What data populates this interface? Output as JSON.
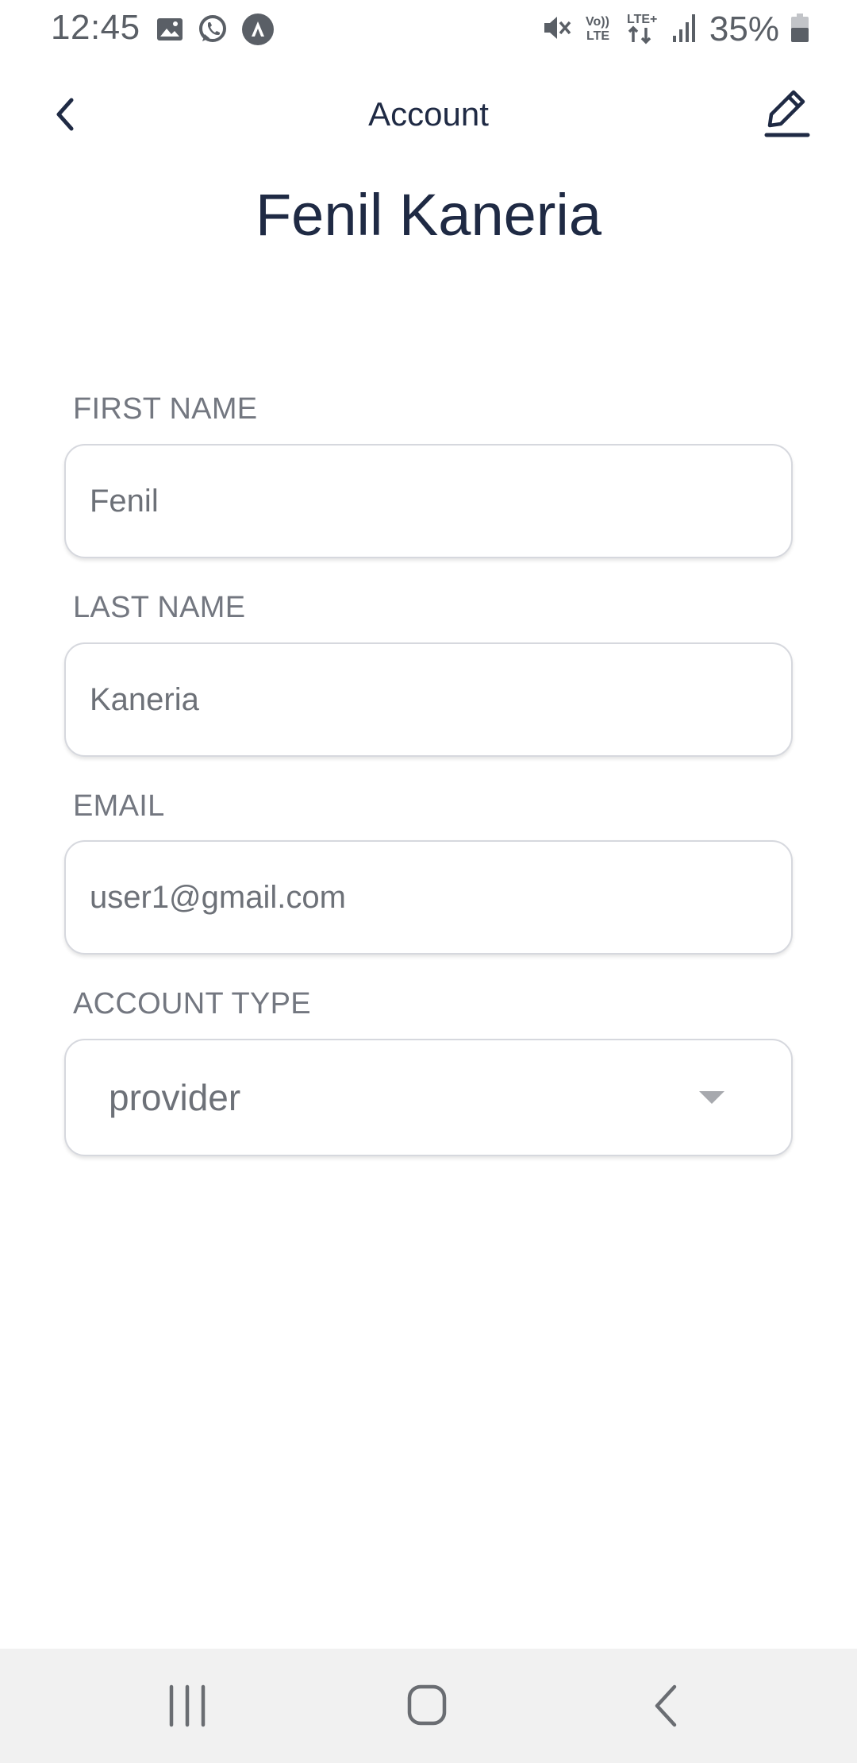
{
  "status_bar": {
    "time": "12:45",
    "battery": "35%",
    "left_icons": [
      "gallery-icon",
      "whatsapp-icon",
      "app-icon"
    ],
    "right_icons": [
      "mute-icon",
      "volte-icon",
      "lte-icon",
      "signal-icon",
      "battery-icon"
    ],
    "volte_text": "Vo)) LTE",
    "lte_text": "LTE+"
  },
  "header": {
    "title": "Account",
    "back_icon": "chevron-left-icon",
    "edit_icon": "pencil-icon"
  },
  "profile": {
    "name": "Fenil Kaneria"
  },
  "form": {
    "first_name": {
      "label": "FIRST NAME",
      "value": "Fenil"
    },
    "last_name": {
      "label": "LAST NAME",
      "value": "Kaneria"
    },
    "email": {
      "label": "EMAIL",
      "value": "user1@gmail.com"
    },
    "account_type": {
      "label": "ACCOUNT TYPE",
      "value": "provider"
    }
  },
  "nav_bar": {
    "icons": [
      "recent-apps-icon",
      "home-icon",
      "back-icon"
    ]
  },
  "colors": {
    "primary_text": "#1f2a44",
    "label_text": "#737780",
    "field_border": "#d6d8de",
    "nav_background": "#f1f1f1"
  }
}
